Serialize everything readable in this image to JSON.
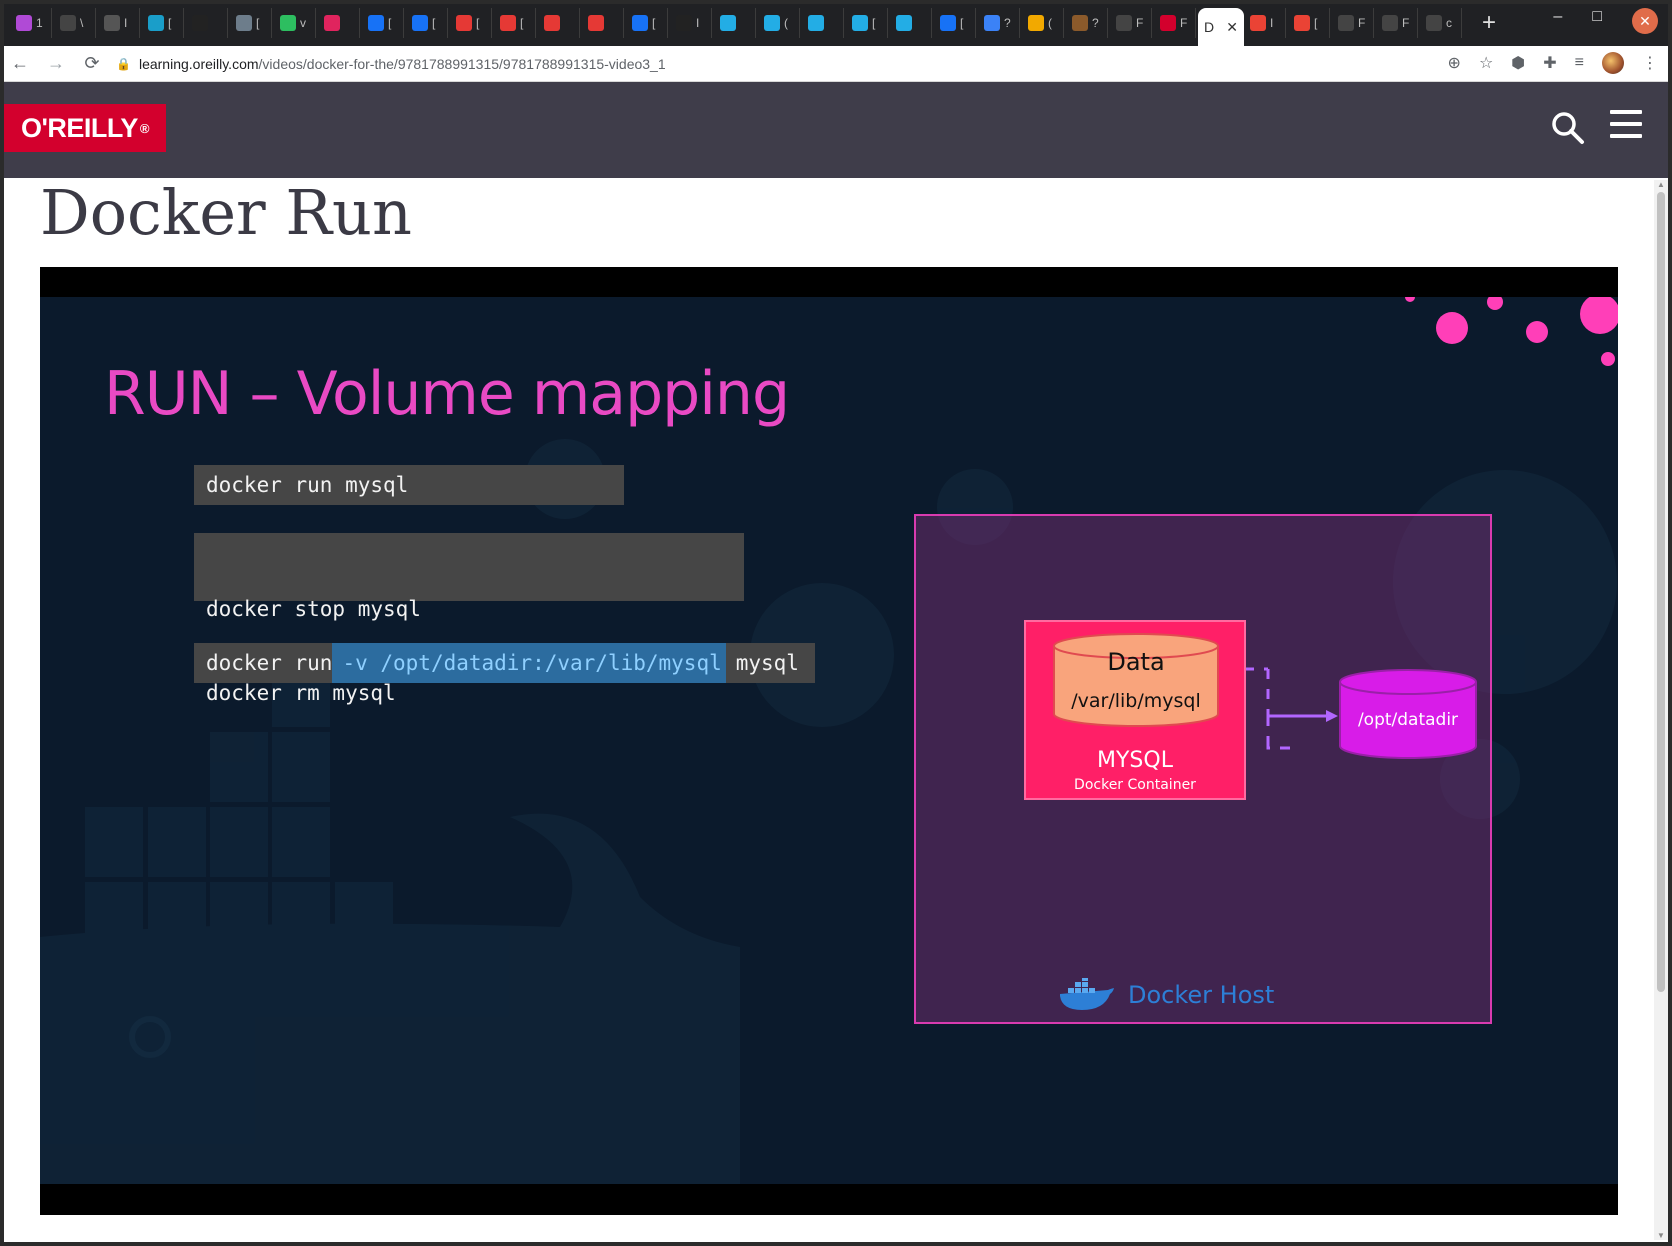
{
  "browser": {
    "tabs": [
      {
        "icon": "podcast-icon",
        "color": "#b04ad6",
        "text": "1"
      },
      {
        "icon": "github-icon",
        "color": "#444444",
        "text": "\\"
      },
      {
        "icon": "arch-icon",
        "color": "#555555",
        "text": "I"
      },
      {
        "icon": "book-icon",
        "color": "#1a9ec9",
        "text": "["
      },
      {
        "icon": "notion-n-icon",
        "color": "#222222",
        "text": ""
      },
      {
        "icon": "image-icon",
        "color": "#6d7d8b",
        "text": "["
      },
      {
        "icon": "evernote-icon",
        "color": "#2dbe60",
        "text": "v"
      },
      {
        "icon": "scribble-icon",
        "color": "#e0245e",
        "text": ""
      },
      {
        "icon": "zhihu-icon",
        "color": "#1772f6",
        "text": "["
      },
      {
        "icon": "zhihu-icon",
        "color": "#1772f6",
        "text": "["
      },
      {
        "icon": "csdn-icon",
        "color": "#e53935",
        "text": "["
      },
      {
        "icon": "target-icon",
        "color": "#e53935",
        "text": "["
      },
      {
        "icon": "huawei-icon",
        "color": "#e53935",
        "text": ""
      },
      {
        "icon": "huawei-icon",
        "color": "#e53935",
        "text": ""
      },
      {
        "icon": "zhihu-icon",
        "color": "#1772f6",
        "text": "["
      },
      {
        "icon": "notion-icon",
        "color": "#222222",
        "text": "I"
      },
      {
        "icon": "bilibili-icon",
        "color": "#23ade5",
        "text": ""
      },
      {
        "icon": "bilibili-icon",
        "color": "#23ade5",
        "text": "("
      },
      {
        "icon": "bilibili-icon",
        "color": "#23ade5",
        "text": ""
      },
      {
        "icon": "bilibili-icon",
        "color": "#23ade5",
        "text": "["
      },
      {
        "icon": "bilibili-icon",
        "color": "#23ade5",
        "text": ""
      },
      {
        "icon": "zhihu-icon",
        "color": "#1772f6",
        "text": "["
      },
      {
        "icon": "translate-icon",
        "color": "#3b82f6",
        "text": "?"
      },
      {
        "icon": "bolt-icon",
        "color": "#f2a900",
        "text": "("
      },
      {
        "icon": "avatar-icon",
        "color": "#8b5a2b",
        "text": "?"
      },
      {
        "icon": "github-icon",
        "color": "#444444",
        "text": "F"
      },
      {
        "icon": "oreilly-icon",
        "color": "#d3002d",
        "text": "F"
      },
      {
        "icon": "gmail-icon",
        "color": "#ea4335",
        "text": "I"
      },
      {
        "icon": "gmail-icon",
        "color": "#ea4335",
        "text": "["
      },
      {
        "icon": "github-icon",
        "color": "#444444",
        "text": "F"
      },
      {
        "icon": "github-icon",
        "color": "#444444",
        "text": "F"
      },
      {
        "icon": "github-icon",
        "color": "#444444",
        "text": "c"
      }
    ],
    "active_tab": {
      "text": "D",
      "close": "✕"
    },
    "new_tab": "+",
    "window_controls": {
      "minimize": "–",
      "maximize": "□",
      "close": "✕"
    },
    "url_host": "learning.oreilly.com",
    "url_path": "/videos/docker-for-the/9781788991315/9781788991315-video3_1"
  },
  "site": {
    "logo_text": "O'REILLY",
    "logo_reg": "®",
    "brand_color": "#d3002d",
    "header_color": "#3f3d4a"
  },
  "page": {
    "title": "Docker Run"
  },
  "slide": {
    "title": "RUN – Volume mapping",
    "title_color": "#e94ac4",
    "commands": {
      "run_basic": "docker run mysql",
      "stop": "docker stop mysql",
      "rm": "docker rm mysql",
      "run_volume_prefix": "docker run",
      "run_volume_highlight": "-v /opt/datadir:/var/lib/mysql",
      "run_volume_suffix": "mysql"
    },
    "diagram": {
      "data_label": "Data",
      "data_path": "/var/lib/mysql",
      "container_name": "MYSQL",
      "container_caption": "Docker Container",
      "host_path": "/opt/datadir",
      "host_label": "Docker Host",
      "colors": {
        "host_border": "#d93bb0",
        "container": "#ff1f67",
        "data_cylinder": "#f9a47c",
        "host_cylinder": "#d81ce8",
        "arrow": "#b266ff",
        "docker_blue": "#2d7fd6"
      }
    }
  }
}
